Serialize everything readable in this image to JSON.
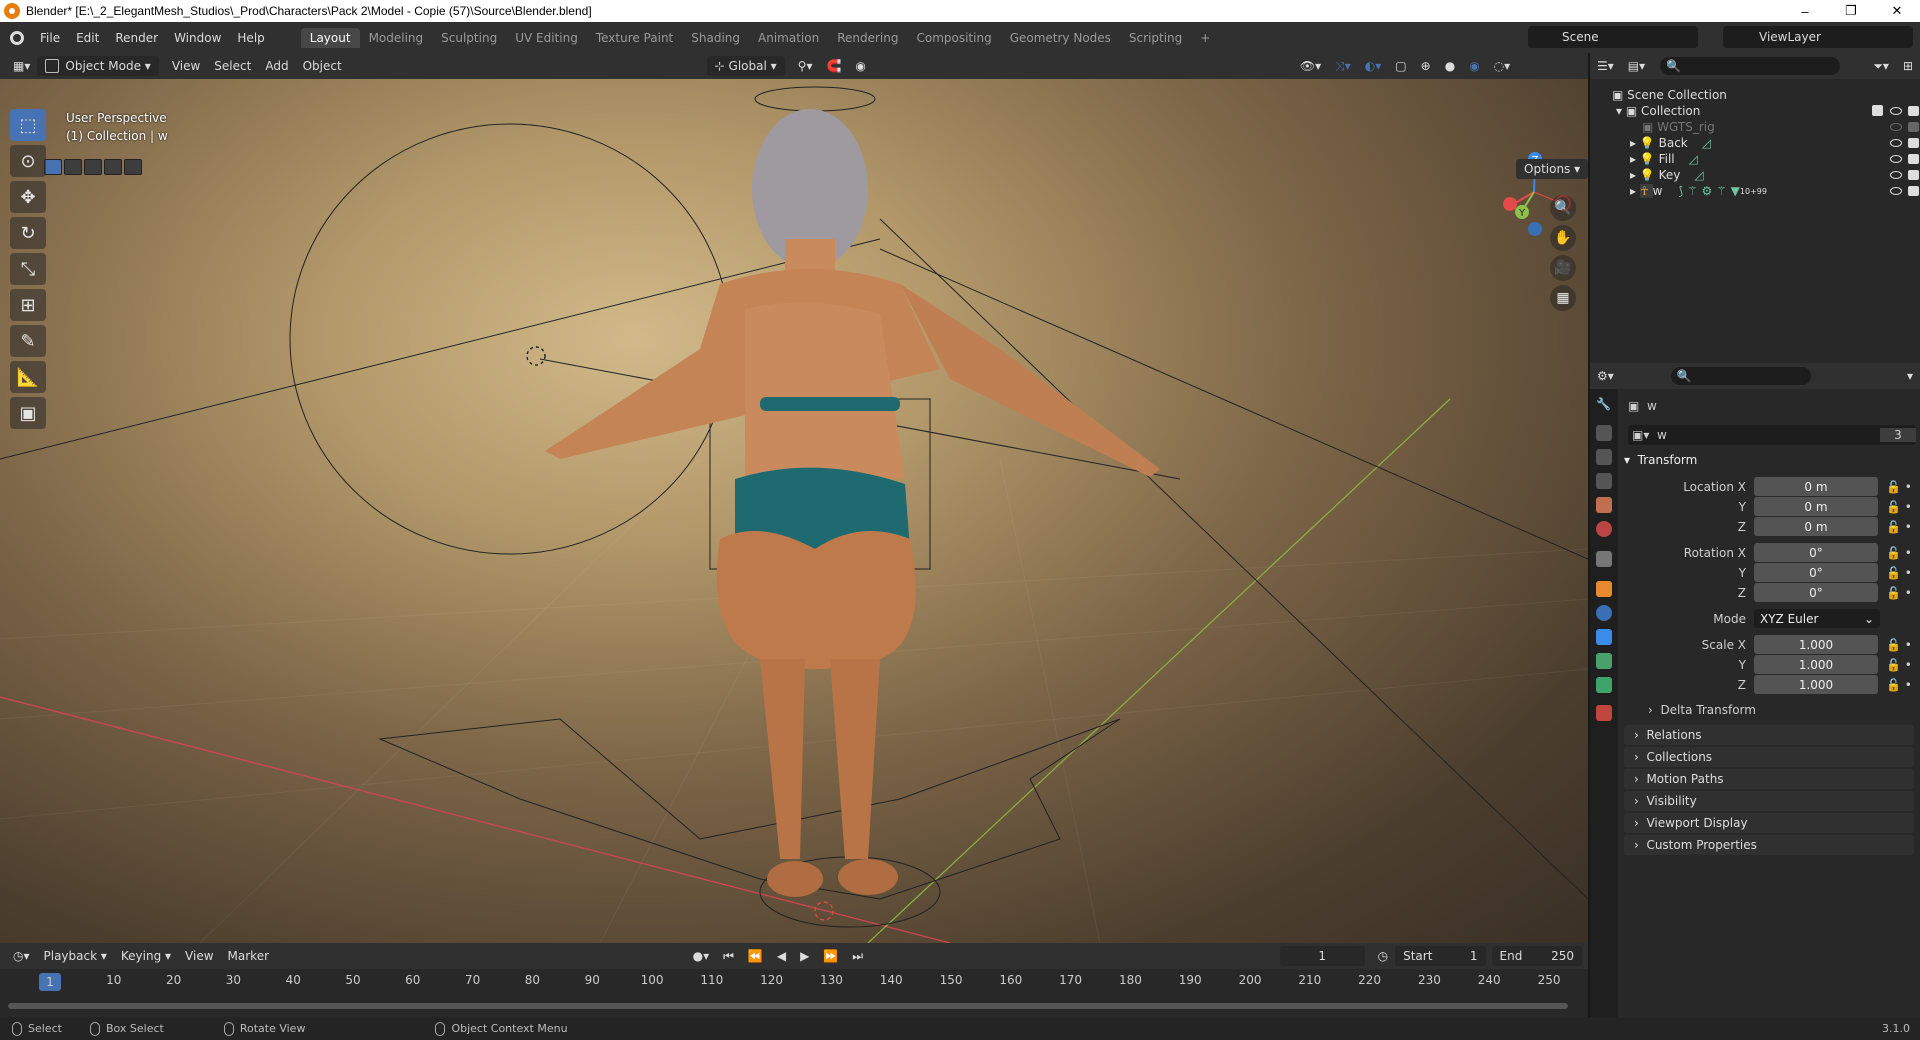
{
  "window": {
    "title": "Blender* [E:\\_2_ElegantMesh_Studios\\_Prod\\Characters\\Pack 2\\Model - Copie (57)\\Source\\Blender.blend]",
    "min": "–",
    "max": "❐",
    "close": "✕"
  },
  "menu": [
    "File",
    "Edit",
    "Render",
    "Window",
    "Help"
  ],
  "workspaces": [
    "Layout",
    "Modeling",
    "Sculpting",
    "UV Editing",
    "Texture Paint",
    "Shading",
    "Animation",
    "Rendering",
    "Compositing",
    "Geometry Nodes",
    "Scripting"
  ],
  "workspace_add": "+",
  "scene": "Scene",
  "view_layer": "ViewLayer",
  "viewport_header": {
    "mode": "Object Mode",
    "items": [
      "View",
      "Select",
      "Add",
      "Object"
    ],
    "orientation": "Global"
  },
  "viewport": {
    "line1": "User Perspective",
    "line2": "(1) Collection | w",
    "options": "Options"
  },
  "gizmo": {
    "z": "Z",
    "y": "Y"
  },
  "outliner": {
    "root": "Scene Collection",
    "rows": [
      "Collection",
      "WGTS_rig",
      "Back",
      "Fill",
      "Key",
      "w"
    ],
    "w_count": "10",
    "w_more": "99"
  },
  "properties": {
    "object_name": "w",
    "datablock": "w",
    "users": "3",
    "transform_title": "Transform",
    "loc_labels": [
      "Location X",
      "Y",
      "Z"
    ],
    "loc": [
      "0 m",
      "0 m",
      "0 m"
    ],
    "rot_labels": [
      "Rotation X",
      "Y",
      "Z"
    ],
    "rot": [
      "0°",
      "0°",
      "0°"
    ],
    "mode_label": "Mode",
    "mode": "XYZ Euler",
    "scale_labels": [
      "Scale X",
      "Y",
      "Z"
    ],
    "scale": [
      "1.000",
      "1.000",
      "1.000"
    ],
    "delta": "Delta Transform",
    "panels": [
      "Relations",
      "Collections",
      "Motion Paths",
      "Visibility",
      "Viewport Display",
      "Custom Properties"
    ]
  },
  "timeline": {
    "menus": [
      "Playback",
      "Keying",
      "View",
      "Marker"
    ],
    "current": "1",
    "start_label": "Start",
    "start": "1",
    "end_label": "End",
    "end": "250",
    "ruler": [
      "1",
      "10",
      "20",
      "30",
      "40",
      "50",
      "60",
      "70",
      "80",
      "90",
      "100",
      "110",
      "120",
      "130",
      "140",
      "150",
      "160",
      "170",
      "180",
      "190",
      "200",
      "210",
      "220",
      "230",
      "240",
      "250"
    ]
  },
  "status": {
    "select": "Select",
    "box": "Box Select",
    "rotate": "Rotate View",
    "ctx": "Object Context Menu",
    "version": "3.1.0"
  },
  "colors": {
    "accent": "#4772b3",
    "x_axis": "#e54a4a",
    "y_axis": "#8bc34a",
    "z_axis": "#3b8beb",
    "bg": "#303030"
  }
}
